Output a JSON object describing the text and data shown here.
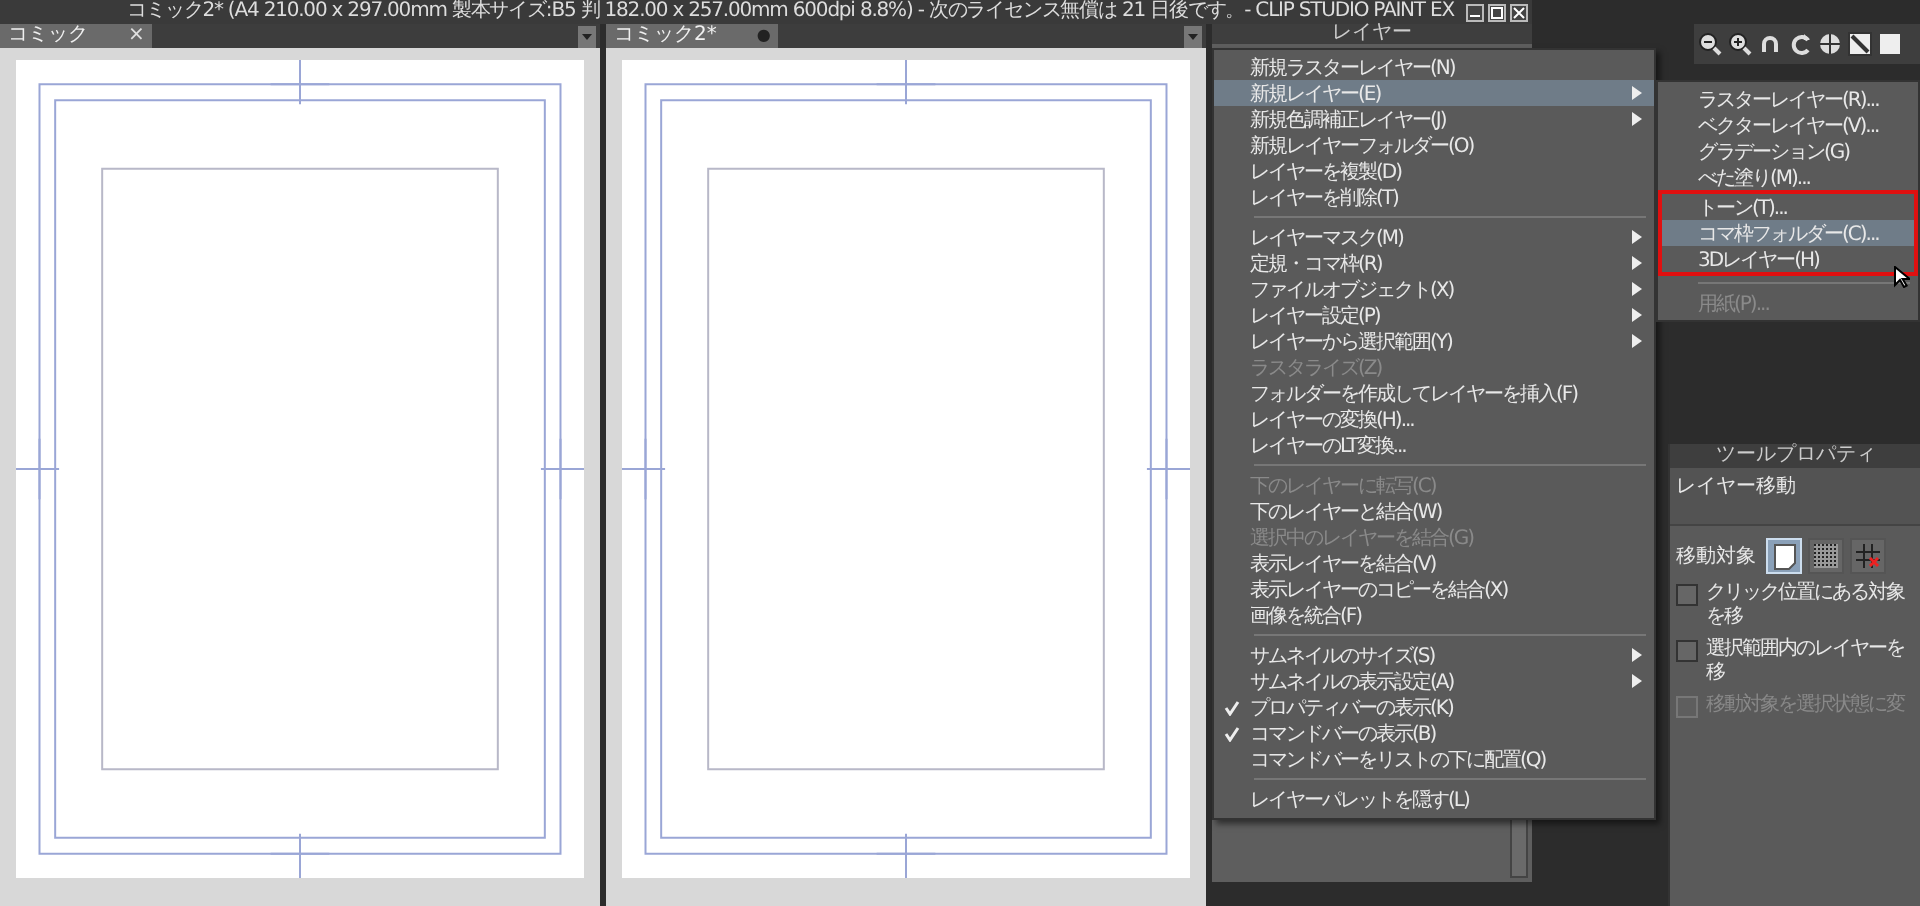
{
  "window": {
    "title": "コミック2* (A4 210.00 x 297.00mm 製本サイズ:B5 判 182.00 x 257.00mm 600dpi 8.8%) - 次のライセンス無償は 21 日後です。- CLIP STUDIO PAINT EX"
  },
  "canvas_tabs": [
    {
      "label": "コミック",
      "close": "×",
      "unsaved": false,
      "selected": true
    },
    {
      "label": "コミック2*",
      "close": "●",
      "unsaved": true,
      "selected": true
    }
  ],
  "layer_palette": {
    "title": "レイヤー"
  },
  "layer_menu": [
    {
      "kind": "item",
      "label": "新規ラスターレイヤー(N)",
      "disabled": false,
      "checked": false,
      "submenu": false,
      "selected": false
    },
    {
      "kind": "item",
      "label": "新規レイヤー(E)",
      "disabled": false,
      "checked": false,
      "submenu": true,
      "selected": true
    },
    {
      "kind": "item",
      "label": "新規色調補正レイヤー(J)",
      "disabled": false,
      "checked": false,
      "submenu": true,
      "selected": false
    },
    {
      "kind": "item",
      "label": "新規レイヤーフォルダー(O)",
      "disabled": false,
      "checked": false,
      "submenu": false,
      "selected": false
    },
    {
      "kind": "item",
      "label": "レイヤーを複製(D)",
      "disabled": false,
      "checked": false,
      "submenu": false,
      "selected": false
    },
    {
      "kind": "item",
      "label": "レイヤーを削除(T)",
      "disabled": false,
      "checked": false,
      "submenu": false,
      "selected": false
    },
    {
      "kind": "separator"
    },
    {
      "kind": "item",
      "label": "レイヤーマスク(M)",
      "disabled": false,
      "checked": false,
      "submenu": true,
      "selected": false
    },
    {
      "kind": "item",
      "label": "定規・コマ枠(R)",
      "disabled": false,
      "checked": false,
      "submenu": true,
      "selected": false
    },
    {
      "kind": "item",
      "label": "ファイルオブジェクト(X)",
      "disabled": false,
      "checked": false,
      "submenu": true,
      "selected": false
    },
    {
      "kind": "item",
      "label": "レイヤー設定(P)",
      "disabled": false,
      "checked": false,
      "submenu": true,
      "selected": false
    },
    {
      "kind": "item",
      "label": "レイヤーから選択範囲(Y)",
      "disabled": false,
      "checked": false,
      "submenu": true,
      "selected": false
    },
    {
      "kind": "item",
      "label": "ラスタライズ(Z)",
      "disabled": true,
      "checked": false,
      "submenu": false,
      "selected": false
    },
    {
      "kind": "item",
      "label": "フォルダーを作成してレイヤーを挿入(F)",
      "disabled": false,
      "checked": false,
      "submenu": false,
      "selected": false
    },
    {
      "kind": "item",
      "label": "レイヤーの変換(H)...",
      "disabled": false,
      "checked": false,
      "submenu": false,
      "selected": false
    },
    {
      "kind": "item",
      "label": "レイヤーのLT変換...",
      "disabled": false,
      "checked": false,
      "submenu": false,
      "selected": false
    },
    {
      "kind": "separator"
    },
    {
      "kind": "item",
      "label": "下のレイヤーに転写(C)",
      "disabled": true,
      "checked": false,
      "submenu": false,
      "selected": false
    },
    {
      "kind": "item",
      "label": "下のレイヤーと結合(W)",
      "disabled": false,
      "checked": false,
      "submenu": false,
      "selected": false
    },
    {
      "kind": "item",
      "label": "選択中のレイヤーを結合(G)",
      "disabled": true,
      "checked": false,
      "submenu": false,
      "selected": false
    },
    {
      "kind": "item",
      "label": "表示レイヤーを結合(V)",
      "disabled": false,
      "checked": false,
      "submenu": false,
      "selected": false
    },
    {
      "kind": "item",
      "label": "表示レイヤーのコピーを結合(X)",
      "disabled": false,
      "checked": false,
      "submenu": false,
      "selected": false
    },
    {
      "kind": "item",
      "label": "画像を統合(F)",
      "disabled": false,
      "checked": false,
      "submenu": false,
      "selected": false
    },
    {
      "kind": "separator"
    },
    {
      "kind": "item",
      "label": "サムネイルのサイズ(S)",
      "disabled": false,
      "checked": false,
      "submenu": true,
      "selected": false
    },
    {
      "kind": "item",
      "label": "サムネイルの表示設定(A)",
      "disabled": false,
      "checked": false,
      "submenu": true,
      "selected": false
    },
    {
      "kind": "item",
      "label": "プロパティバーの表示(K)",
      "disabled": false,
      "checked": true,
      "submenu": false,
      "selected": false
    },
    {
      "kind": "item",
      "label": "コマンドバーの表示(B)",
      "disabled": false,
      "checked": true,
      "submenu": false,
      "selected": false
    },
    {
      "kind": "item",
      "label": "コマンドバーをリストの下に配置(Q)",
      "disabled": false,
      "checked": false,
      "submenu": false,
      "selected": false
    },
    {
      "kind": "separator"
    },
    {
      "kind": "item",
      "label": "レイヤーパレットを隠す(L)",
      "disabled": false,
      "checked": false,
      "submenu": false,
      "selected": false
    }
  ],
  "new_layer_submenu": [
    {
      "kind": "item",
      "label": "ラスターレイヤー(R)...",
      "disabled": false,
      "selected": false,
      "highlighted": false
    },
    {
      "kind": "item",
      "label": "ベクターレイヤー(V)...",
      "disabled": false,
      "selected": false,
      "highlighted": false
    },
    {
      "kind": "item",
      "label": "グラデーション(G)",
      "disabled": false,
      "selected": false,
      "highlighted": false
    },
    {
      "kind": "item",
      "label": "べた塗り(M)...",
      "disabled": false,
      "selected": false,
      "highlighted": false
    },
    {
      "kind": "item",
      "label": "トーン(T)...",
      "disabled": false,
      "selected": false,
      "highlighted": true
    },
    {
      "kind": "item",
      "label": "コマ枠フォルダー(C)...",
      "disabled": false,
      "selected": true,
      "highlighted": true
    },
    {
      "kind": "item",
      "label": "3Dレイヤー(H)",
      "disabled": false,
      "selected": false,
      "highlighted": true
    },
    {
      "kind": "separator"
    },
    {
      "kind": "item",
      "label": "用紙(P)...",
      "disabled": true,
      "selected": false,
      "highlighted": false
    }
  ],
  "tool_property": {
    "title": "ツールプロパティ",
    "subtool": "レイヤー移動",
    "target_label": "移動対象",
    "targets": [
      {
        "kind": "layer",
        "selected": true
      },
      {
        "kind": "tone",
        "selected": false
      },
      {
        "kind": "grid",
        "selected": false
      }
    ],
    "options": [
      {
        "label": "クリック位置にある対象を移",
        "checked": false,
        "disabled": false
      },
      {
        "label": "選択範囲内のレイヤーを移",
        "checked": false,
        "disabled": false
      },
      {
        "label": "移動対象を選択状態に変",
        "checked": false,
        "disabled": true
      }
    ]
  }
}
